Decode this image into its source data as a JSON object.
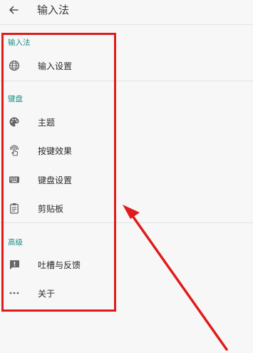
{
  "appbar": {
    "title": "输入法",
    "back_icon": "arrow-left-icon"
  },
  "sections": {
    "input_method": {
      "header": "输入法",
      "items": [
        {
          "label": "输入设置",
          "icon": "globe-icon"
        }
      ]
    },
    "keyboard": {
      "header": "键盘",
      "items": [
        {
          "label": "主题",
          "icon": "palette-icon"
        },
        {
          "label": "按键效果",
          "icon": "touch-icon"
        },
        {
          "label": "键盘设置",
          "icon": "keyboard-icon"
        },
        {
          "label": "剪贴板",
          "icon": "clipboard-icon"
        }
      ]
    },
    "advanced": {
      "header": "高级",
      "items": [
        {
          "label": "吐槽与反馈",
          "icon": "feedback-icon"
        },
        {
          "label": "关于",
          "icon": "more-horizontal-icon"
        }
      ]
    }
  },
  "colors": {
    "accent": "#1a8f85",
    "annotation": "#e01b1b",
    "background": "#f7f7f7"
  }
}
